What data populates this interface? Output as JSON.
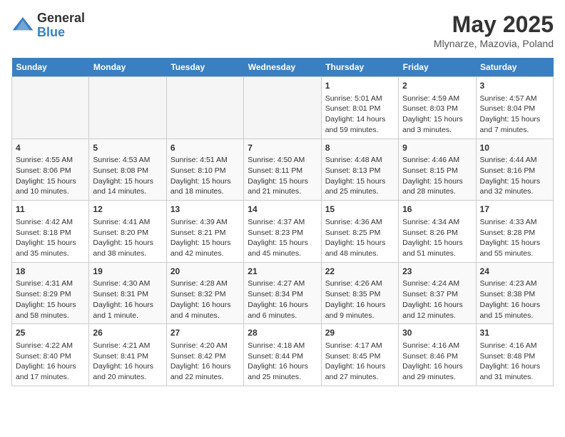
{
  "header": {
    "logo_general": "General",
    "logo_blue": "Blue",
    "month_title": "May 2025",
    "location": "Mlynarze, Mazovia, Poland"
  },
  "days_of_week": [
    "Sunday",
    "Monday",
    "Tuesday",
    "Wednesday",
    "Thursday",
    "Friday",
    "Saturday"
  ],
  "weeks": [
    [
      {
        "day": "",
        "info": ""
      },
      {
        "day": "",
        "info": ""
      },
      {
        "day": "",
        "info": ""
      },
      {
        "day": "",
        "info": ""
      },
      {
        "day": "1",
        "info": "Sunrise: 5:01 AM\nSunset: 8:01 PM\nDaylight: 14 hours and 59 minutes."
      },
      {
        "day": "2",
        "info": "Sunrise: 4:59 AM\nSunset: 8:03 PM\nDaylight: 15 hours and 3 minutes."
      },
      {
        "day": "3",
        "info": "Sunrise: 4:57 AM\nSunset: 8:04 PM\nDaylight: 15 hours and 7 minutes."
      }
    ],
    [
      {
        "day": "4",
        "info": "Sunrise: 4:55 AM\nSunset: 8:06 PM\nDaylight: 15 hours and 10 minutes."
      },
      {
        "day": "5",
        "info": "Sunrise: 4:53 AM\nSunset: 8:08 PM\nDaylight: 15 hours and 14 minutes."
      },
      {
        "day": "6",
        "info": "Sunrise: 4:51 AM\nSunset: 8:10 PM\nDaylight: 15 hours and 18 minutes."
      },
      {
        "day": "7",
        "info": "Sunrise: 4:50 AM\nSunset: 8:11 PM\nDaylight: 15 hours and 21 minutes."
      },
      {
        "day": "8",
        "info": "Sunrise: 4:48 AM\nSunset: 8:13 PM\nDaylight: 15 hours and 25 minutes."
      },
      {
        "day": "9",
        "info": "Sunrise: 4:46 AM\nSunset: 8:15 PM\nDaylight: 15 hours and 28 minutes."
      },
      {
        "day": "10",
        "info": "Sunrise: 4:44 AM\nSunset: 8:16 PM\nDaylight: 15 hours and 32 minutes."
      }
    ],
    [
      {
        "day": "11",
        "info": "Sunrise: 4:42 AM\nSunset: 8:18 PM\nDaylight: 15 hours and 35 minutes."
      },
      {
        "day": "12",
        "info": "Sunrise: 4:41 AM\nSunset: 8:20 PM\nDaylight: 15 hours and 38 minutes."
      },
      {
        "day": "13",
        "info": "Sunrise: 4:39 AM\nSunset: 8:21 PM\nDaylight: 15 hours and 42 minutes."
      },
      {
        "day": "14",
        "info": "Sunrise: 4:37 AM\nSunset: 8:23 PM\nDaylight: 15 hours and 45 minutes."
      },
      {
        "day": "15",
        "info": "Sunrise: 4:36 AM\nSunset: 8:25 PM\nDaylight: 15 hours and 48 minutes."
      },
      {
        "day": "16",
        "info": "Sunrise: 4:34 AM\nSunset: 8:26 PM\nDaylight: 15 hours and 51 minutes."
      },
      {
        "day": "17",
        "info": "Sunrise: 4:33 AM\nSunset: 8:28 PM\nDaylight: 15 hours and 55 minutes."
      }
    ],
    [
      {
        "day": "18",
        "info": "Sunrise: 4:31 AM\nSunset: 8:29 PM\nDaylight: 15 hours and 58 minutes."
      },
      {
        "day": "19",
        "info": "Sunrise: 4:30 AM\nSunset: 8:31 PM\nDaylight: 16 hours and 1 minute."
      },
      {
        "day": "20",
        "info": "Sunrise: 4:28 AM\nSunset: 8:32 PM\nDaylight: 16 hours and 4 minutes."
      },
      {
        "day": "21",
        "info": "Sunrise: 4:27 AM\nSunset: 8:34 PM\nDaylight: 16 hours and 6 minutes."
      },
      {
        "day": "22",
        "info": "Sunrise: 4:26 AM\nSunset: 8:35 PM\nDaylight: 16 hours and 9 minutes."
      },
      {
        "day": "23",
        "info": "Sunrise: 4:24 AM\nSunset: 8:37 PM\nDaylight: 16 hours and 12 minutes."
      },
      {
        "day": "24",
        "info": "Sunrise: 4:23 AM\nSunset: 8:38 PM\nDaylight: 16 hours and 15 minutes."
      }
    ],
    [
      {
        "day": "25",
        "info": "Sunrise: 4:22 AM\nSunset: 8:40 PM\nDaylight: 16 hours and 17 minutes."
      },
      {
        "day": "26",
        "info": "Sunrise: 4:21 AM\nSunset: 8:41 PM\nDaylight: 16 hours and 20 minutes."
      },
      {
        "day": "27",
        "info": "Sunrise: 4:20 AM\nSunset: 8:42 PM\nDaylight: 16 hours and 22 minutes."
      },
      {
        "day": "28",
        "info": "Sunrise: 4:18 AM\nSunset: 8:44 PM\nDaylight: 16 hours and 25 minutes."
      },
      {
        "day": "29",
        "info": "Sunrise: 4:17 AM\nSunset: 8:45 PM\nDaylight: 16 hours and 27 minutes."
      },
      {
        "day": "30",
        "info": "Sunrise: 4:16 AM\nSunset: 8:46 PM\nDaylight: 16 hours and 29 minutes."
      },
      {
        "day": "31",
        "info": "Sunrise: 4:16 AM\nSunset: 8:48 PM\nDaylight: 16 hours and 31 minutes."
      }
    ]
  ]
}
